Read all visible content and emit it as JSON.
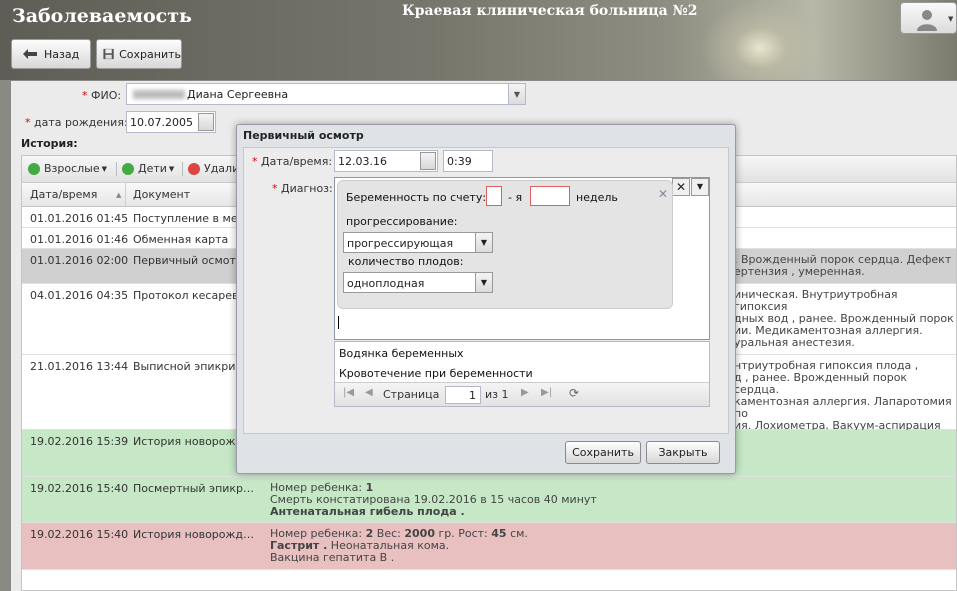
{
  "header": {
    "app_title": "Заболеваемость",
    "hospital_title": "Краевая клиническая больница №2",
    "user_icon": "user-icon"
  },
  "toolbar": {
    "back_label": "Назад",
    "save_label": "Сохранить"
  },
  "patient": {
    "fio_label": "ФИО:",
    "fio_value": "Диана Сергеевна",
    "dob_label": "дата рождения:",
    "dob_value": "10.07.2005"
  },
  "history": {
    "title": "История:",
    "toolbar": {
      "adults": "Взрослые",
      "children": "Дети",
      "delete": "Удали"
    },
    "columns": [
      "Дата/время",
      "Документ"
    ],
    "rows": [
      {
        "date": "01.01.2016 01:45",
        "doc": "Поступление в мед.у",
        "right": ""
      },
      {
        "date": "01.01.2016 01:46",
        "doc": "Обменная карта",
        "right": ""
      },
      {
        "date": "01.01.2016 02:00",
        "doc": "Первичный осмотр",
        "right": ". Врожденный порок сердца. Дефект\nертензия , умеренная."
      },
      {
        "date": "04.01.2016 04:35",
        "doc": "Протокол кесарева с",
        "right": "иническая. Внутриутробная гипоксия\nдных вод , ранее. Врожденный порок\nии. Медикаментозная аллергия.\nуральная анестезия."
      },
      {
        "date": "21.01.2016 13:44",
        "doc": "Выписной эпикриз",
        "right": "нтриутробная гипоксия плода ,\nд , ранее. Врожденный порок сердца.\nкаментозная аллергия. Лапаротомия по\nия. Лохиометра. Вакуум-аспирация\nиперпролактинемия. Сахарный диабет."
      },
      {
        "date": "19.02.2016 15:39",
        "doc": "История новорожден",
        "right": ""
      },
      {
        "date": "19.02.2016 15:40",
        "doc": "Посмертный эпикриз ...",
        "l1a": "Номер ребенка: ",
        "l1b": "1",
        "l2": "Смерть констатирована 19.02.2016 в 15 часов 40 минут",
        "l3": "Антенатальная гибель плода ."
      },
      {
        "date": "19.02.2016 15:40",
        "doc": "История новорожденн...",
        "l1a": "Номер ребенка: ",
        "l1b": "2",
        "l1c": " Вес: ",
        "l1d": "2000",
        "l1e": " гр. Рост: ",
        "l1f": "45",
        "l1g": " см.",
        "l2a": "Гастрит .",
        "l2b": " Неонатальная кома.",
        "l3": "Вакцина гепатита В ."
      }
    ]
  },
  "modal": {
    "title": "Первичный осмотр",
    "datetime_label": "Дата/время:",
    "date_value": "12.03.16",
    "time_value": "0:39",
    "diagnosis_label": "Диагноз:",
    "pregnancy": {
      "count_label": "Беременность по счету:",
      "count_suffix": "- я",
      "weeks_label": "недель",
      "progress_label": "прогрессирование:",
      "progress_value": "прогрессирующая",
      "fetus_label": "количество плодов:",
      "fetus_value": "одноплодная"
    },
    "suggestions": [
      "Водянка беременных",
      "Кровотечение при беременности"
    ],
    "pager": {
      "page_label": "Страница",
      "page_value": "1",
      "of_label": "из 1"
    },
    "save_label": "Сохранить",
    "close_label": "Закрыть"
  }
}
